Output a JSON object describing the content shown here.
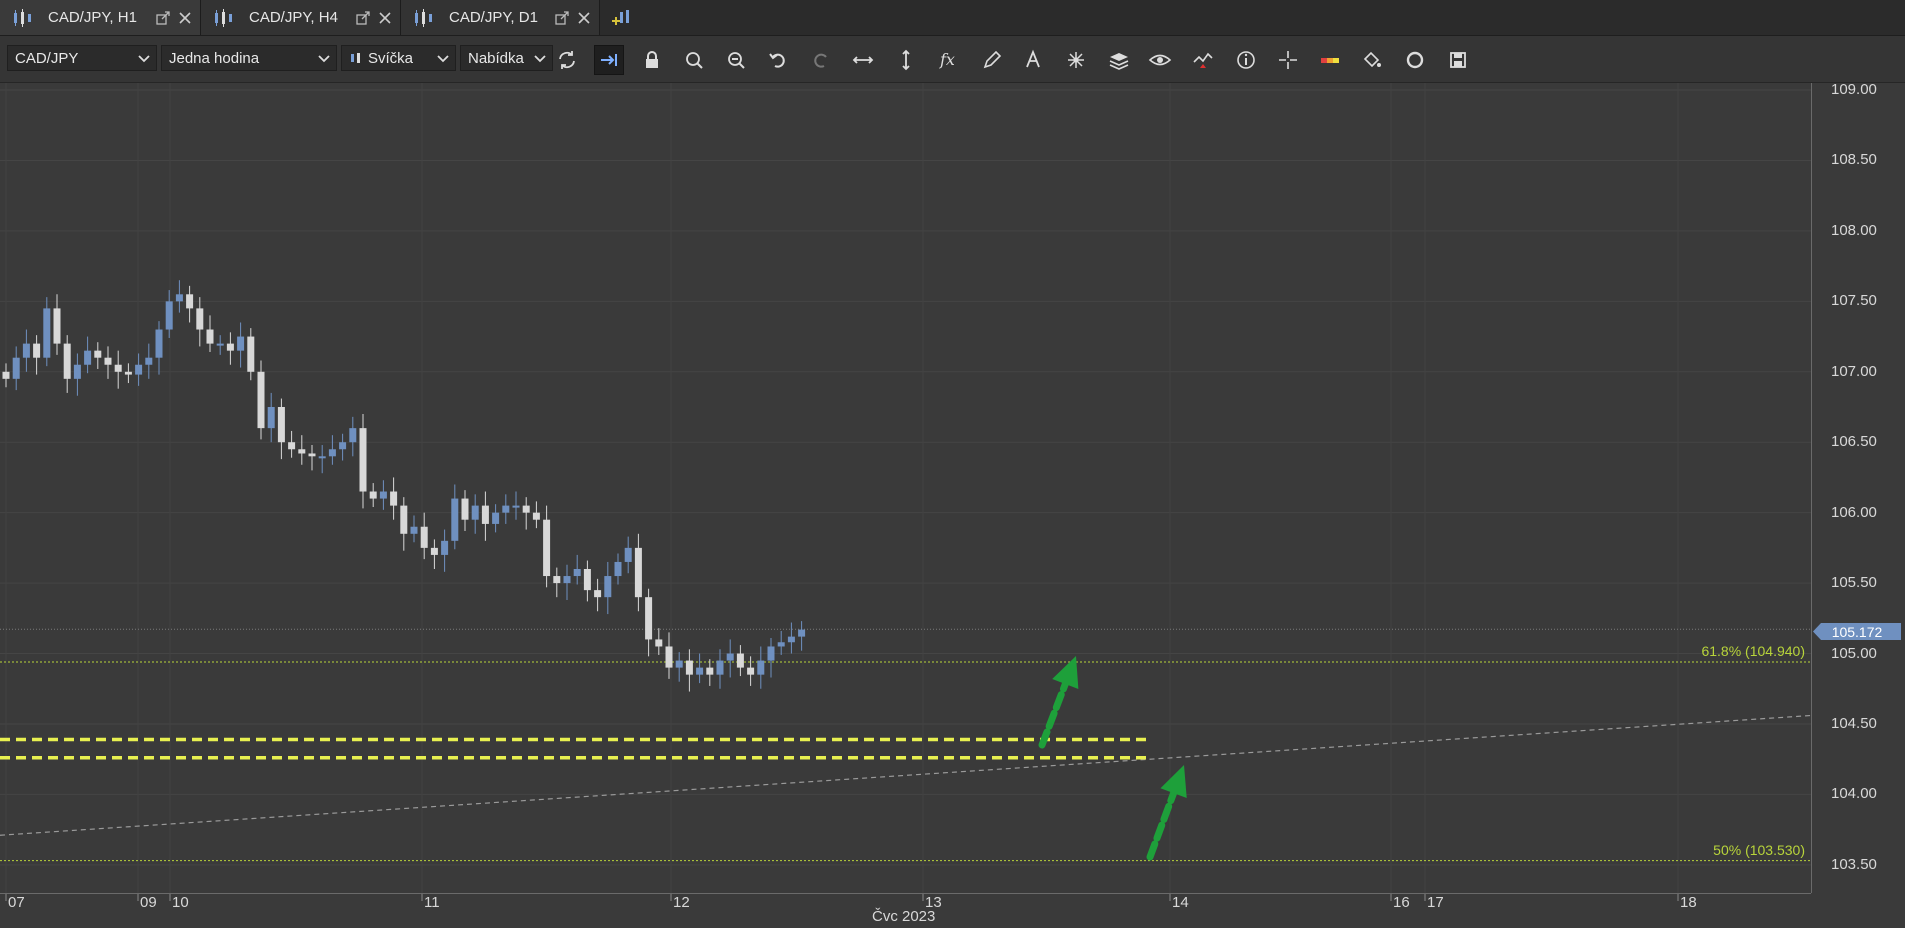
{
  "tabs": [
    {
      "label": "CAD/JPY, H1",
      "active": true
    },
    {
      "label": "CAD/JPY, H4",
      "active": false
    },
    {
      "label": "CAD/JPY, D1",
      "active": false
    }
  ],
  "toolbar": {
    "instrument": "CAD/JPY",
    "period": "Jedna hodina",
    "chart_type": "Svíčka",
    "price_side": "Nabídka",
    "icons": [
      "refresh-icon",
      "chart-shift-icon",
      "lock-icon",
      "zoom-in-icon",
      "zoom-out-icon",
      "undo-icon",
      "redo-icon",
      "horizontal-scale-icon",
      "vertical-scale-icon",
      "indicator-fx-icon",
      "pencil-icon",
      "text-tool-icon",
      "pattern-icon",
      "layers-icon",
      "eye-icon",
      "chart-style-icon",
      "info-icon",
      "crosshair-icon",
      "color-bar-icon",
      "paint-bucket-icon",
      "sync-icon",
      "save-icon"
    ]
  },
  "colors": {
    "background": "#3a3a3a",
    "bull_candle": "#6f90c0",
    "bear_candle": "#d8d8d8",
    "fib_line": "#b8d43a",
    "zone_line": "#e8f050",
    "arrow": "#1ea03a",
    "trendline": "#9a9a9a"
  },
  "chart_data": {
    "type": "candlestick",
    "instrument": "CAD/JPY",
    "timeframe": "H1",
    "ylim": [
      103.3,
      109.05
    ],
    "y_ticks": [
      "109.00",
      "108.50",
      "108.00",
      "107.50",
      "107.00",
      "106.50",
      "106.00",
      "105.50",
      "105.00",
      "104.50",
      "104.00",
      "103.50"
    ],
    "x_ticks": [
      "07",
      "09",
      "10",
      "11",
      "12",
      "13",
      "14",
      "16",
      "17",
      "18"
    ],
    "x_month_label": "Čvc 2023",
    "current_price": "105.172",
    "fib_levels": [
      {
        "label": "61.8% (104.940)",
        "value": 104.94
      },
      {
        "label": "50% (103.530)",
        "value": 103.53
      }
    ],
    "support_zone": [
      104.26,
      104.39
    ],
    "trendline": {
      "from": 103.71,
      "to": 104.56
    },
    "candles_close": [
      106.95,
      107.1,
      107.2,
      107.1,
      107.45,
      107.2,
      106.95,
      107.05,
      107.15,
      107.1,
      107.05,
      107.0,
      106.98,
      107.05,
      107.1,
      107.3,
      107.5,
      107.55,
      107.45,
      107.3,
      107.2,
      107.2,
      107.15,
      107.25,
      107.0,
      106.6,
      106.75,
      106.5,
      106.45,
      106.42,
      106.4,
      106.4,
      106.45,
      106.5,
      106.6,
      106.15,
      106.1,
      106.15,
      106.05,
      105.85,
      105.9,
      105.75,
      105.7,
      105.8,
      106.1,
      105.95,
      106.05,
      105.92,
      106.0,
      106.05,
      106.05,
      106.0,
      105.95,
      105.55,
      105.5,
      105.55,
      105.6,
      105.45,
      105.4,
      105.55,
      105.65,
      105.75,
      105.4,
      105.1,
      105.05,
      104.9,
      104.95,
      104.85,
      104.9,
      104.85,
      104.95,
      105.0,
      104.9,
      104.85,
      104.95,
      105.05,
      105.08,
      105.12,
      105.17
    ],
    "candles_open": [
      107.0,
      106.95,
      107.1,
      107.2,
      107.1,
      107.45,
      107.2,
      106.95,
      107.05,
      107.15,
      107.1,
      107.05,
      107.0,
      106.98,
      107.05,
      107.1,
      107.3,
      107.5,
      107.55,
      107.45,
      107.3,
      107.2,
      107.2,
      107.15,
      107.25,
      107.0,
      106.6,
      106.75,
      106.5,
      106.45,
      106.42,
      106.4,
      106.4,
      106.45,
      106.5,
      106.6,
      106.15,
      106.1,
      106.15,
      106.05,
      105.85,
      105.9,
      105.75,
      105.7,
      105.8,
      106.1,
      105.95,
      106.05,
      105.92,
      106.0,
      106.05,
      106.05,
      106.0,
      105.95,
      105.55,
      105.5,
      105.55,
      105.6,
      105.45,
      105.4,
      105.55,
      105.65,
      105.75,
      105.4,
      105.1,
      105.05,
      104.9,
      104.95,
      104.85,
      104.9,
      104.85,
      104.95,
      105.0,
      104.9,
      104.85,
      104.95,
      105.05,
      105.08,
      105.12
    ]
  }
}
